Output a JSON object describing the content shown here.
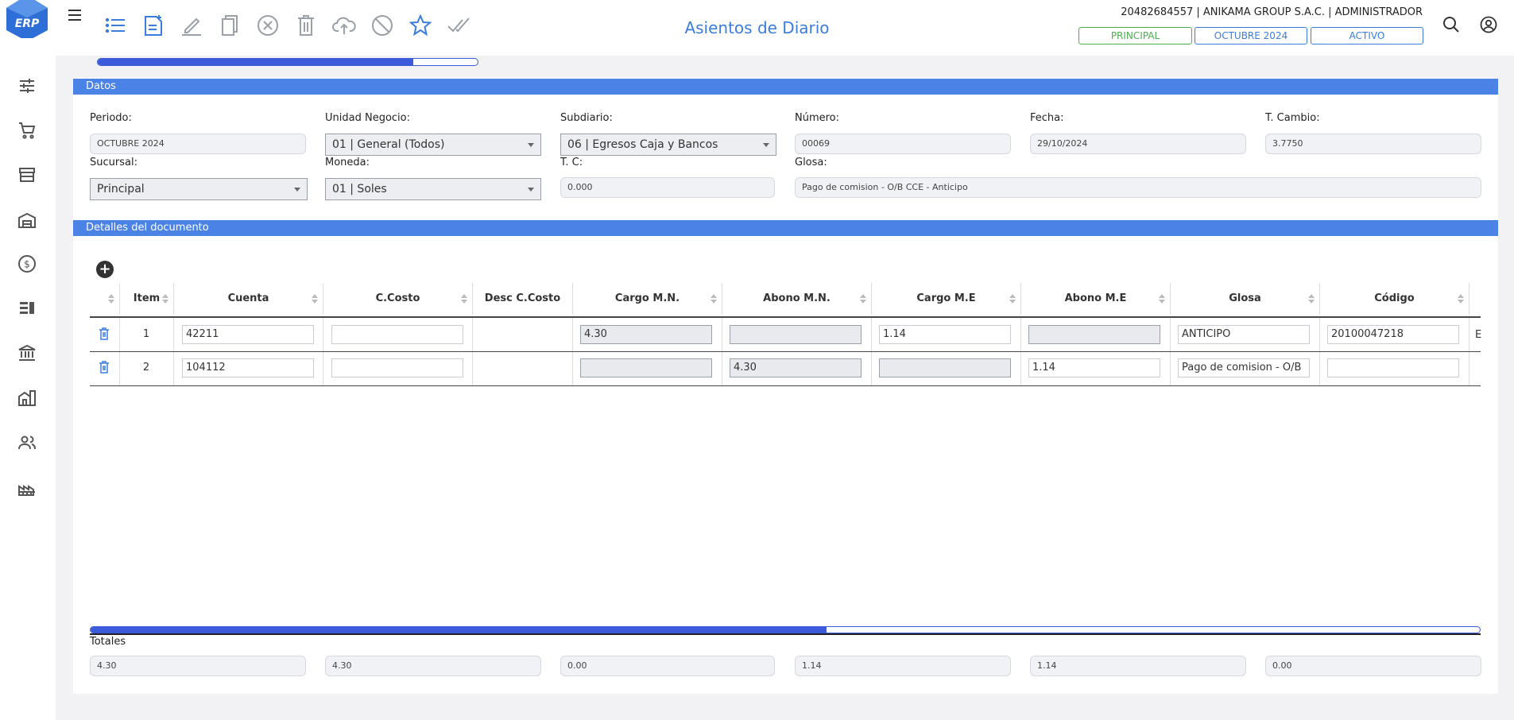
{
  "app": {
    "logo_text": "ERP",
    "title": "Asientos de Diario",
    "company": "20482684557 | ANIKAMA GROUP S.A.C. | ADMINISTRADOR",
    "badges": [
      "PRINCIPAL",
      "OCTUBRE 2024",
      "ACTIVO"
    ]
  },
  "toolbar": {
    "icons": [
      "list-icon",
      "new-document-icon",
      "edit-icon",
      "copy-icon",
      "cancel-icon",
      "delete-icon",
      "upload-icon",
      "block-icon",
      "favorite-icon",
      "approve-icon"
    ]
  },
  "sidebar": {
    "icons": [
      "settings-sliders-icon",
      "cart-icon",
      "store-icon",
      "warehouse-icon",
      "money-icon",
      "document-list-icon",
      "bank-icon",
      "building-icon",
      "users-icon",
      "factory-icon"
    ]
  },
  "progress": {
    "value": 0.83
  },
  "datos": {
    "header": "Datos",
    "periodo": {
      "label": "Periodo:",
      "value": "OCTUBRE 2024"
    },
    "unidad_negocio": {
      "label": "Unidad Negocio:",
      "value": "01 | General (Todos)"
    },
    "subdiario": {
      "label": "Subdiario:",
      "value": "06 | Egresos Caja y Bancos"
    },
    "numero": {
      "label": "Número:",
      "value": "00069"
    },
    "fecha": {
      "label": "Fecha:",
      "value": "29/10/2024"
    },
    "t_cambio": {
      "label": "T. Cambio:",
      "value": "3.7750"
    },
    "sucursal": {
      "label": "Sucursal:",
      "value": "Principal"
    },
    "moneda": {
      "label": "Moneda:",
      "value": "01 | Soles"
    },
    "tc": {
      "label": "T. C:",
      "value": "0.000"
    },
    "glosa": {
      "label": "Glosa:",
      "value": "Pago de comision - O/B CCE - Anticipo"
    }
  },
  "detalles": {
    "header": "Detalles del documento",
    "columns": [
      "Item",
      "Cuenta",
      "C.Costo",
      "Desc C.Costo",
      "Cargo M.N.",
      "Abono M.N.",
      "Cargo M.E",
      "Abono M.E",
      "Glosa",
      "Código"
    ],
    "rows": [
      {
        "item": "1",
        "cuenta": "42211",
        "ccosto": "",
        "desc_ccosto": "",
        "cargo_mn": "4.30",
        "abono_mn": "",
        "cargo_me": "1.14",
        "abono_me": "",
        "glosa": "ANTICIPO",
        "codigo": "20100047218",
        "extra": "E"
      },
      {
        "item": "2",
        "cuenta": "104112",
        "ccosto": "",
        "desc_ccosto": "",
        "cargo_mn": "",
        "abono_mn": "4.30",
        "cargo_me": "",
        "abono_me": "1.14",
        "glosa": "Pago de comision - O/B",
        "codigo": "",
        "extra": ""
      }
    ]
  },
  "scroll": {
    "value": 0.53
  },
  "totales": {
    "label": "Totales",
    "values": [
      "4.30",
      "4.30",
      "0.00",
      "1.14",
      "1.14",
      "0.00"
    ]
  },
  "colors": {
    "accent": "#3b7ddd",
    "section": "#4b82e6",
    "progress": "#3b5bdb",
    "badge_green": "#4caf50"
  }
}
